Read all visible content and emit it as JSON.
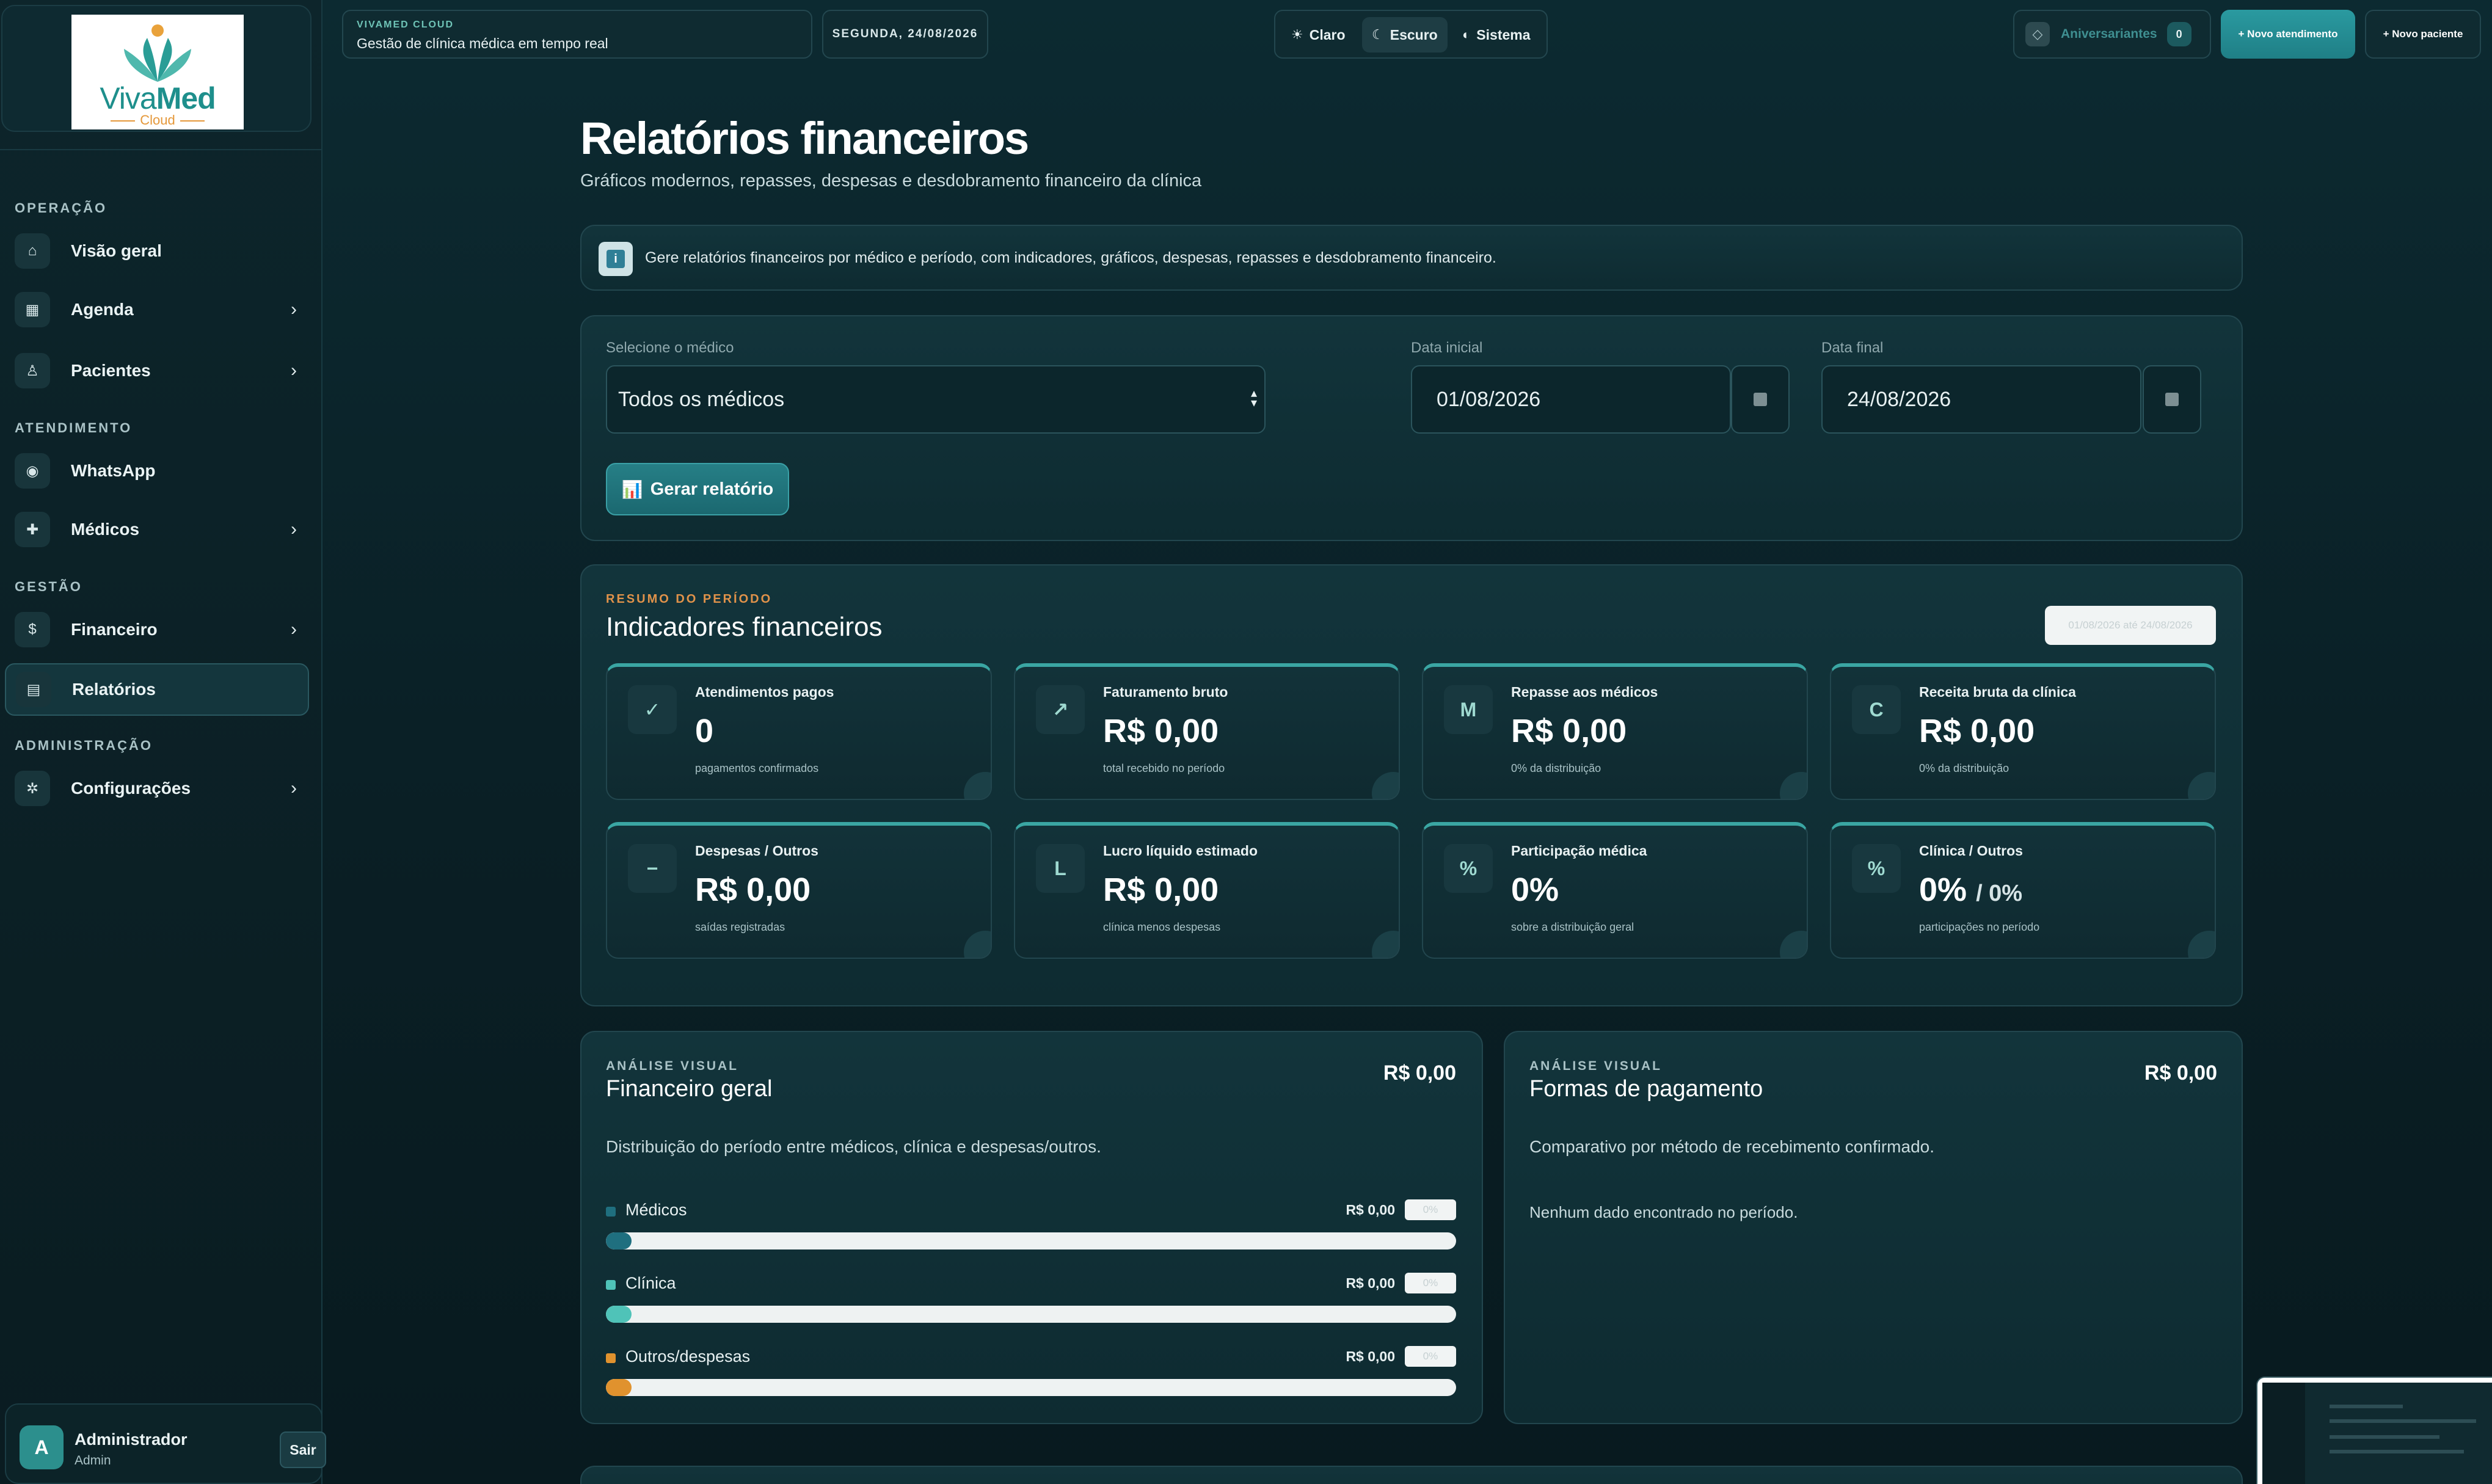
{
  "brand": {
    "logo_name": "Viva",
    "logo_name_bold": "Med",
    "logo_sub": "Cloud",
    "tag": "VIVAMED CLOUD",
    "subtitle": "Gestão de clínica médica em tempo real"
  },
  "header": {
    "date": "SEGUNDA, 24/08/2026",
    "themes": [
      {
        "label": "Claro",
        "active": false
      },
      {
        "label": "Escuro",
        "active": true
      },
      {
        "label": "Sistema",
        "active": false
      }
    ],
    "birthdays_label": "Aniversariantes",
    "birthdays_count": "0",
    "new_appointment": "+ Novo atendimento",
    "new_patient": "+ Novo paciente"
  },
  "sidebar": {
    "sections": {
      "operacao": "OPERAÇÃO",
      "atendimento": "ATENDIMENTO",
      "gestao": "GESTÃO",
      "administracao": "ADMINISTRAÇÃO"
    },
    "items": [
      {
        "label": "Visão geral",
        "icon": "home-icon"
      },
      {
        "label": "Agenda",
        "icon": "calendar-icon"
      },
      {
        "label": "Pacientes",
        "icon": "user-icon"
      },
      {
        "label": "WhatsApp",
        "icon": "whatsapp-icon"
      },
      {
        "label": "Médicos",
        "icon": "medical-cross-icon"
      },
      {
        "label": "Financeiro",
        "icon": "dollar-icon"
      },
      {
        "label": "Relatórios",
        "icon": "report-icon"
      },
      {
        "label": "Configurações",
        "icon": "gear-icon"
      }
    ],
    "user": {
      "initial": "A",
      "name": "Administrador",
      "role": "Admin",
      "logout": "Sair"
    }
  },
  "page": {
    "title": "Relatórios financeiros",
    "subtitle": "Gráficos modernos, repasses, despesas e desdobramento financeiro da clínica",
    "info": "Gere relatórios financeiros por médico e período, com indicadores, gráficos, despesas, repasses e desdobramento financeiro."
  },
  "filters": {
    "doctor_label": "Selecione o médico",
    "doctor_value": "Todos os médicos",
    "start_label": "Data inicial",
    "start_value": "01/08/2026",
    "end_label": "Data final",
    "end_value": "24/08/2026",
    "generate": "Gerar relatório"
  },
  "summary": {
    "eyebrow": "RESUMO DO PERÍODO",
    "title": "Indicadores financeiros",
    "period": "01/08/2026 até 24/08/2026",
    "kpis": [
      {
        "icon": "✓",
        "label": "Atendimentos pagos",
        "value": "0",
        "sub": "pagamentos confirmados"
      },
      {
        "icon": "↗",
        "label": "Faturamento bruto",
        "value": "R$ 0,00",
        "sub": "total recebido no período"
      },
      {
        "icon": "M",
        "label": "Repasse aos médicos",
        "value": "R$ 0,00",
        "sub": "0% da distribuição"
      },
      {
        "icon": "C",
        "label": "Receita bruta da clínica",
        "value": "R$ 0,00",
        "sub": "0% da distribuição"
      },
      {
        "icon": "−",
        "label": "Despesas / Outros",
        "value": "R$ 0,00",
        "sub": "saídas registradas"
      },
      {
        "icon": "L",
        "label": "Lucro líquido estimado",
        "value": "R$ 0,00",
        "sub": "clínica menos despesas"
      },
      {
        "icon": "%",
        "label": "Participação médica",
        "value": "0%",
        "sub": "sobre a distribuição geral"
      },
      {
        "icon": "%",
        "label": "Clínica / Outros",
        "value": "0%",
        "value_extra": "/ 0%",
        "sub": "participações no período"
      }
    ]
  },
  "financeiro_geral": {
    "eyebrow": "ANÁLISE VISUAL",
    "title": "Financeiro geral",
    "total": "R$ 0,00",
    "desc": "Distribuição do período entre médicos, clínica e despesas/outros.",
    "rows": [
      {
        "name": "Médicos",
        "amount": "R$ 0,00",
        "pct": "0%",
        "fraction": 0.03,
        "color": "#1f6f7f"
      },
      {
        "name": "Clínica",
        "amount": "R$ 0,00",
        "pct": "0%",
        "fraction": 0.03,
        "color": "#4fc3b8"
      },
      {
        "name": "Outros/despesas",
        "amount": "R$ 0,00",
        "pct": "0%",
        "fraction": 0.03,
        "color": "#e0922e"
      }
    ]
  },
  "formas_pagamento": {
    "eyebrow": "ANÁLISE VISUAL",
    "title": "Formas de pagamento",
    "total": "R$ 0,00",
    "desc": "Comparativo por método de recebimento confirmado.",
    "empty": "Nenhum dado encontrado no período."
  }
}
